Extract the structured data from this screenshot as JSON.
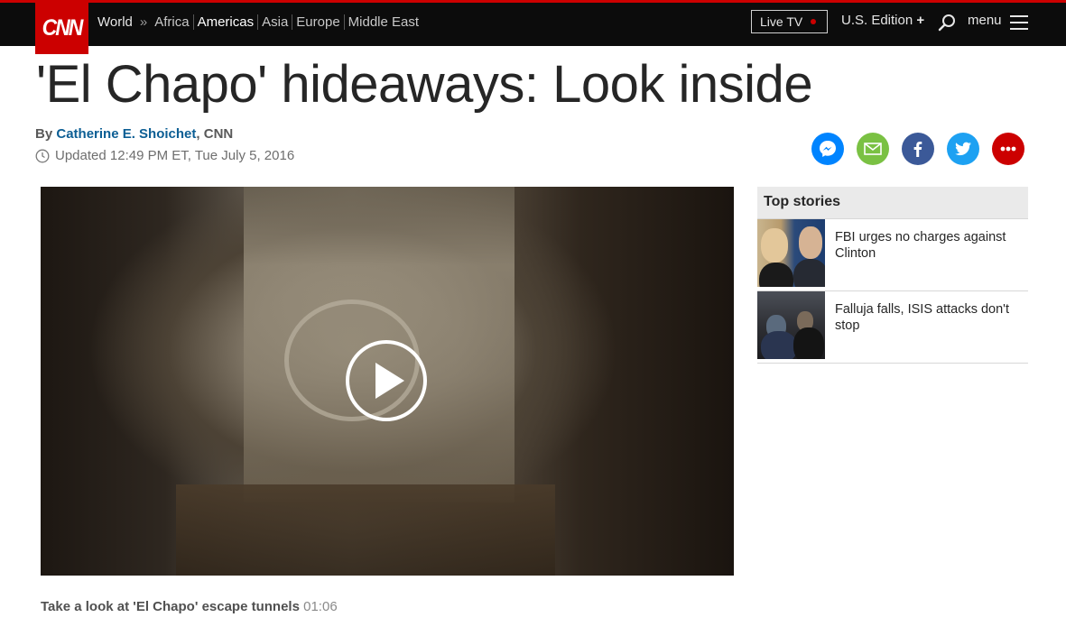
{
  "nav": {
    "logo": "CNN",
    "section": "World",
    "separator": "»",
    "regions": [
      "Africa",
      "Americas",
      "Asia",
      "Europe",
      "Middle East"
    ],
    "active_region": "Americas",
    "live_tv": "Live TV",
    "edition": "U.S. Edition",
    "edition_plus": "+",
    "menu": "menu"
  },
  "article": {
    "headline": "'El Chapo' hideaways: Look inside",
    "by_prefix": "By",
    "author": "Catherine E. Shoichet",
    "source": ", CNN",
    "updated": "Updated 12:49 PM ET, Tue July 5, 2016"
  },
  "share": [
    {
      "name": "messenger",
      "color": "#0084ff"
    },
    {
      "name": "email",
      "color": "#7ac143"
    },
    {
      "name": "facebook",
      "color": "#3b5998"
    },
    {
      "name": "twitter",
      "color": "#1da1f2"
    },
    {
      "name": "more",
      "color": "#cc0000"
    }
  ],
  "video": {
    "caption": "Take a look at 'El Chapo' escape tunnels",
    "duration": "01:06"
  },
  "top_stories": {
    "header": "Top stories",
    "items": [
      {
        "title": "FBI urges no charges against Clinton"
      },
      {
        "title": "Falluja falls, ISIS attacks don't stop"
      }
    ]
  }
}
